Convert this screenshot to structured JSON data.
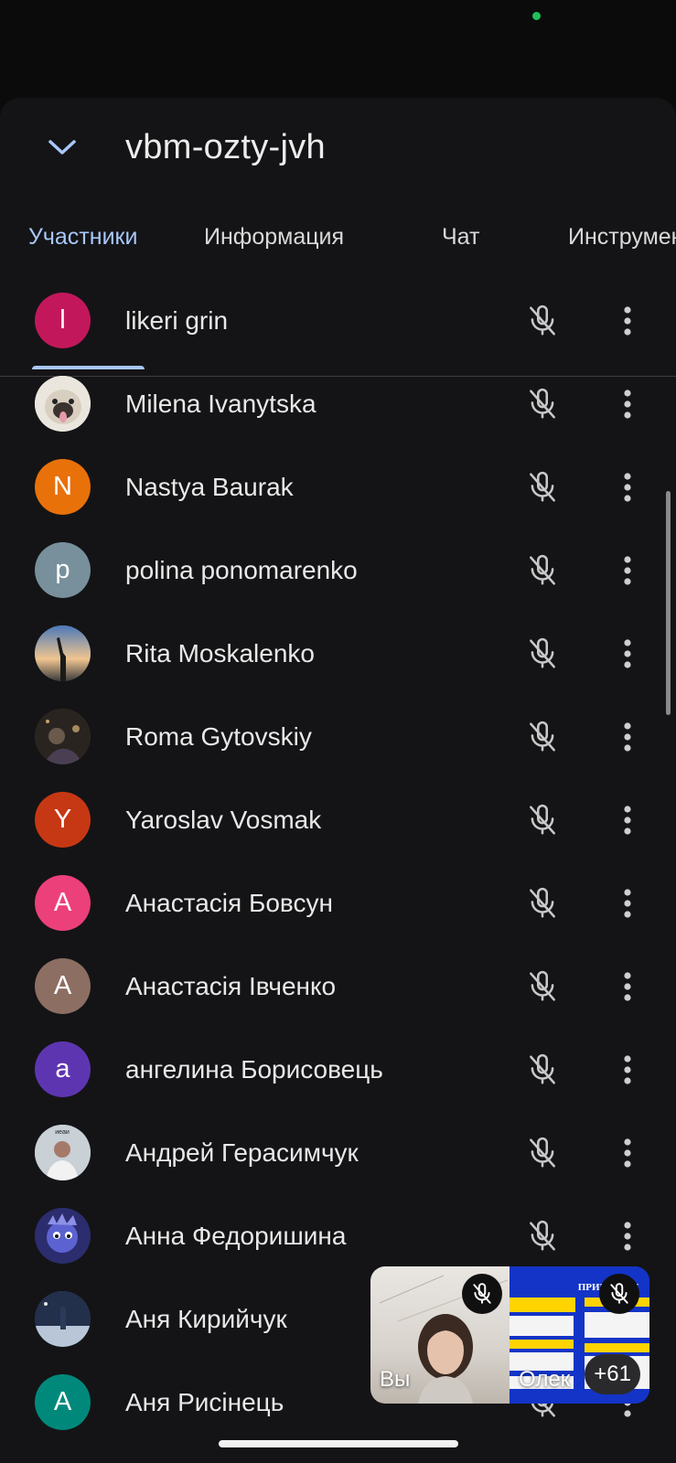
{
  "meeting": {
    "code": "vbm-ozty-jvh"
  },
  "tabs": [
    {
      "label": "Участники",
      "active": true
    },
    {
      "label": "Информация",
      "active": false
    },
    {
      "label": "Чат",
      "active": false
    },
    {
      "label": "Инструменты",
      "active": false
    }
  ],
  "participants": [
    {
      "name": "likeri grin",
      "avatar_letter": "l",
      "avatar_color": "#c2185b",
      "photo": false,
      "muted": true
    },
    {
      "name": "Milena Ivanytska",
      "avatar_letter": "",
      "avatar_color": "#e8e4dc",
      "photo": true,
      "muted": true
    },
    {
      "name": "Nastya Baurak",
      "avatar_letter": "N",
      "avatar_color": "#e8710a",
      "photo": false,
      "muted": true
    },
    {
      "name": "polina ponomarenko",
      "avatar_letter": "p",
      "avatar_color": "#78909c",
      "photo": false,
      "muted": true
    },
    {
      "name": "Rita Moskalenko",
      "avatar_letter": "",
      "avatar_color": "#5d7fa8",
      "photo": true,
      "muted": true
    },
    {
      "name": "Roma Gytovskiy",
      "avatar_letter": "",
      "avatar_color": "#3a3028",
      "photo": true,
      "muted": true
    },
    {
      "name": "Yaroslav Vosmak",
      "avatar_letter": "Y",
      "avatar_color": "#c63813",
      "photo": false,
      "muted": true
    },
    {
      "name": "Анастасія Бовсун",
      "avatar_letter": "A",
      "avatar_color": "#ec407a",
      "photo": false,
      "muted": true
    },
    {
      "name": "Анастасія Івченко",
      "avatar_letter": "A",
      "avatar_color": "#8d6e63",
      "photo": false,
      "muted": true
    },
    {
      "name": "ангелина Борисовець",
      "avatar_letter": "a",
      "avatar_color": "#5e35b1",
      "photo": false,
      "muted": true
    },
    {
      "name": "Андрей Герасимчук",
      "avatar_letter": "",
      "avatar_color": "#b9c3cc",
      "photo": true,
      "muted": true
    },
    {
      "name": "Анна Федоришина",
      "avatar_letter": "",
      "avatar_color": "#2c2f72",
      "photo": true,
      "muted": true
    },
    {
      "name": "Аня Кирийчук",
      "avatar_letter": "",
      "avatar_color": "#3d4a66",
      "photo": true,
      "muted": true
    },
    {
      "name": "Аня Рисінець",
      "avatar_letter": "A",
      "avatar_color": "#00897b",
      "photo": false,
      "muted": true
    }
  ],
  "pip": {
    "self_label": "Вы",
    "other_label": "Олек",
    "extra_count": "+61",
    "slide_title": "ПРИНЦИПИ"
  },
  "colors": {
    "accent": "#a8c7fa",
    "background": "#141416",
    "status_dot": "#1ec15b"
  }
}
